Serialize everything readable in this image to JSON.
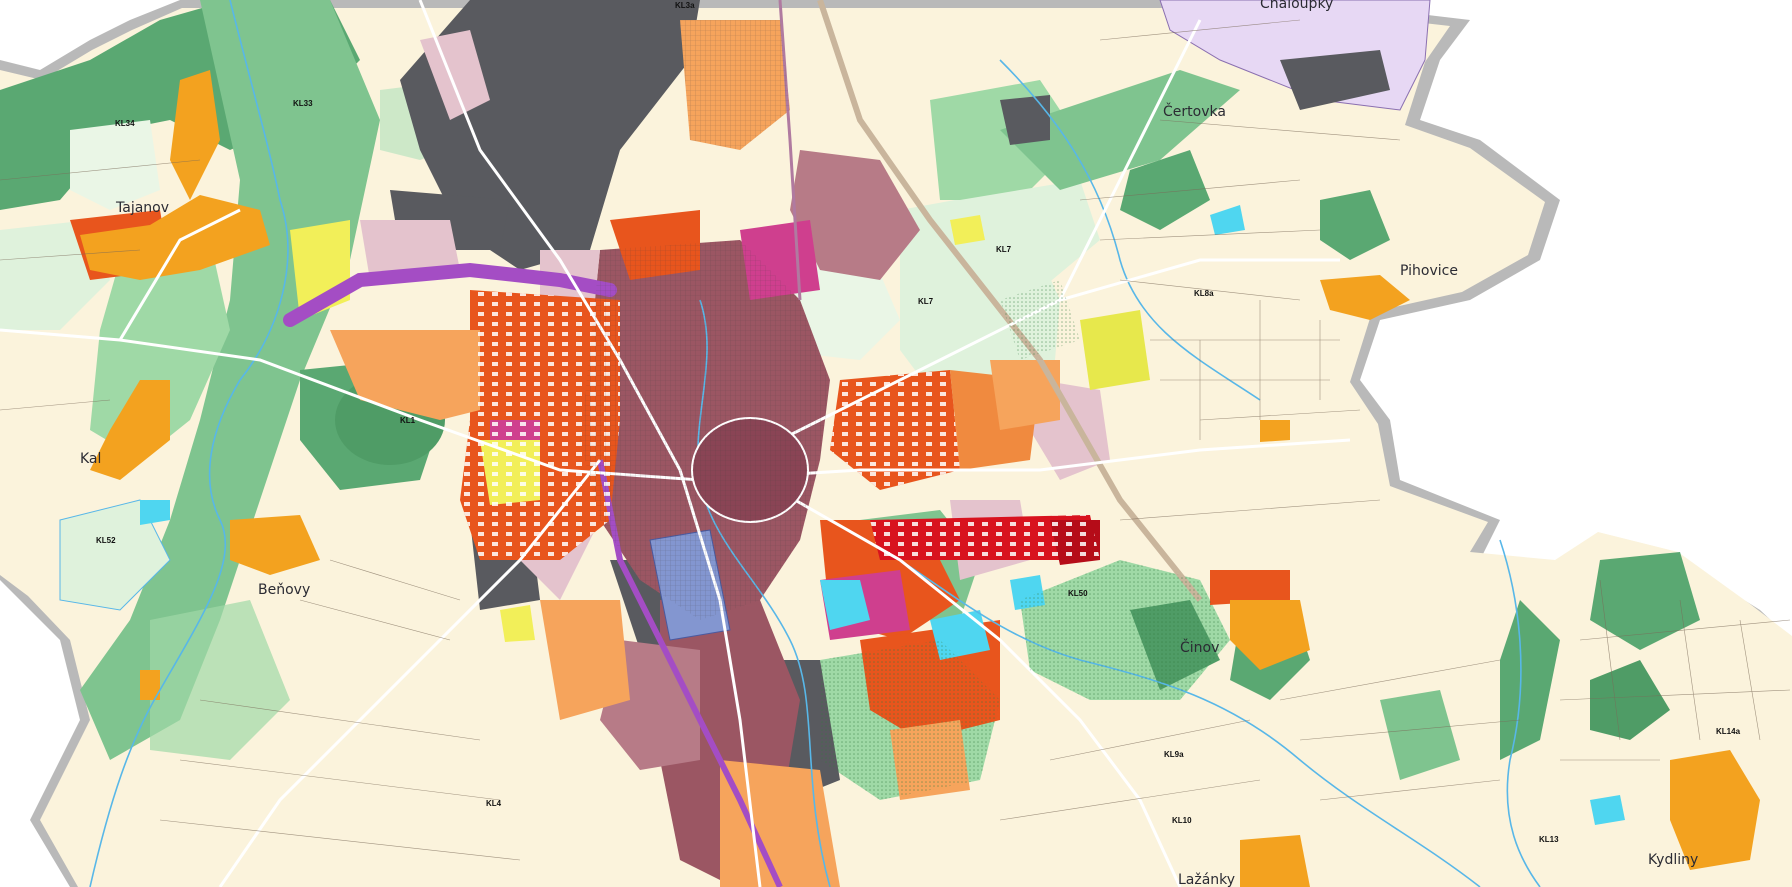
{
  "map": {
    "colors": {
      "background": "#ffffff",
      "outside_buffer": "#b9b9b9",
      "agricultural": "#fbf3dc",
      "meadow": "#dff2dc",
      "forest": "#5aa872",
      "greenery": "#9fd9a6",
      "residential_family": "#f6a45c",
      "residential_urban": "#e8551d",
      "mixed_center": "#9b5663",
      "mixed_light": "#e4c3cd",
      "industry": "#595a5f",
      "civic": "#cf3f8e",
      "civic_special": "#8396d0",
      "sport": "#f2ef59",
      "water": "#4fd6f0",
      "transport_rail": "#a44dc4",
      "special_military": "#e7d8f4",
      "village": "#f3a21f",
      "red_dense": "#d8121e",
      "roads": "#ffffff",
      "parcel_lines": "#7a6a58"
    },
    "place_names": {
      "tajanov": "Tajanov",
      "kal": "Kal",
      "benovy": "Beňovy",
      "certovka": "Čertovka",
      "chaloupky": "Chaloupky",
      "pihovice": "Pihovice",
      "cinov": "Činov",
      "lazanky": "Lažánky",
      "kydliny": "Kydliny"
    },
    "area_codes": {
      "kl33": "KL33",
      "kl3a": "KL3a",
      "kl34": "KL34",
      "kl1": "KL1",
      "kl52": "KL52",
      "kl7": "KL7",
      "kl7b": "KL7",
      "kl8a": "KL8a",
      "kl50": "KL50",
      "kl9a": "KL9a",
      "kl10": "KL10",
      "kl4": "KL4",
      "kl13": "KL13",
      "kl14a": "KL14a"
    }
  }
}
